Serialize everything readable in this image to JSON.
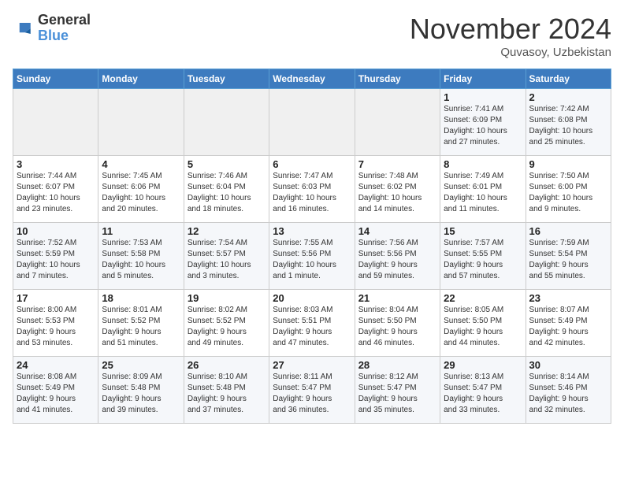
{
  "header": {
    "logo_line1": "General",
    "logo_line2": "Blue",
    "month_title": "November 2024",
    "location": "Quvasoy, Uzbekistan"
  },
  "days_of_week": [
    "Sunday",
    "Monday",
    "Tuesday",
    "Wednesday",
    "Thursday",
    "Friday",
    "Saturday"
  ],
  "weeks": [
    [
      {
        "day": "",
        "info": ""
      },
      {
        "day": "",
        "info": ""
      },
      {
        "day": "",
        "info": ""
      },
      {
        "day": "",
        "info": ""
      },
      {
        "day": "",
        "info": ""
      },
      {
        "day": "1",
        "info": "Sunrise: 7:41 AM\nSunset: 6:09 PM\nDaylight: 10 hours\nand 27 minutes."
      },
      {
        "day": "2",
        "info": "Sunrise: 7:42 AM\nSunset: 6:08 PM\nDaylight: 10 hours\nand 25 minutes."
      }
    ],
    [
      {
        "day": "3",
        "info": "Sunrise: 7:44 AM\nSunset: 6:07 PM\nDaylight: 10 hours\nand 23 minutes."
      },
      {
        "day": "4",
        "info": "Sunrise: 7:45 AM\nSunset: 6:06 PM\nDaylight: 10 hours\nand 20 minutes."
      },
      {
        "day": "5",
        "info": "Sunrise: 7:46 AM\nSunset: 6:04 PM\nDaylight: 10 hours\nand 18 minutes."
      },
      {
        "day": "6",
        "info": "Sunrise: 7:47 AM\nSunset: 6:03 PM\nDaylight: 10 hours\nand 16 minutes."
      },
      {
        "day": "7",
        "info": "Sunrise: 7:48 AM\nSunset: 6:02 PM\nDaylight: 10 hours\nand 14 minutes."
      },
      {
        "day": "8",
        "info": "Sunrise: 7:49 AM\nSunset: 6:01 PM\nDaylight: 10 hours\nand 11 minutes."
      },
      {
        "day": "9",
        "info": "Sunrise: 7:50 AM\nSunset: 6:00 PM\nDaylight: 10 hours\nand 9 minutes."
      }
    ],
    [
      {
        "day": "10",
        "info": "Sunrise: 7:52 AM\nSunset: 5:59 PM\nDaylight: 10 hours\nand 7 minutes."
      },
      {
        "day": "11",
        "info": "Sunrise: 7:53 AM\nSunset: 5:58 PM\nDaylight: 10 hours\nand 5 minutes."
      },
      {
        "day": "12",
        "info": "Sunrise: 7:54 AM\nSunset: 5:57 PM\nDaylight: 10 hours\nand 3 minutes."
      },
      {
        "day": "13",
        "info": "Sunrise: 7:55 AM\nSunset: 5:56 PM\nDaylight: 10 hours\nand 1 minute."
      },
      {
        "day": "14",
        "info": "Sunrise: 7:56 AM\nSunset: 5:56 PM\nDaylight: 9 hours\nand 59 minutes."
      },
      {
        "day": "15",
        "info": "Sunrise: 7:57 AM\nSunset: 5:55 PM\nDaylight: 9 hours\nand 57 minutes."
      },
      {
        "day": "16",
        "info": "Sunrise: 7:59 AM\nSunset: 5:54 PM\nDaylight: 9 hours\nand 55 minutes."
      }
    ],
    [
      {
        "day": "17",
        "info": "Sunrise: 8:00 AM\nSunset: 5:53 PM\nDaylight: 9 hours\nand 53 minutes."
      },
      {
        "day": "18",
        "info": "Sunrise: 8:01 AM\nSunset: 5:52 PM\nDaylight: 9 hours\nand 51 minutes."
      },
      {
        "day": "19",
        "info": "Sunrise: 8:02 AM\nSunset: 5:52 PM\nDaylight: 9 hours\nand 49 minutes."
      },
      {
        "day": "20",
        "info": "Sunrise: 8:03 AM\nSunset: 5:51 PM\nDaylight: 9 hours\nand 47 minutes."
      },
      {
        "day": "21",
        "info": "Sunrise: 8:04 AM\nSunset: 5:50 PM\nDaylight: 9 hours\nand 46 minutes."
      },
      {
        "day": "22",
        "info": "Sunrise: 8:05 AM\nSunset: 5:50 PM\nDaylight: 9 hours\nand 44 minutes."
      },
      {
        "day": "23",
        "info": "Sunrise: 8:07 AM\nSunset: 5:49 PM\nDaylight: 9 hours\nand 42 minutes."
      }
    ],
    [
      {
        "day": "24",
        "info": "Sunrise: 8:08 AM\nSunset: 5:49 PM\nDaylight: 9 hours\nand 41 minutes."
      },
      {
        "day": "25",
        "info": "Sunrise: 8:09 AM\nSunset: 5:48 PM\nDaylight: 9 hours\nand 39 minutes."
      },
      {
        "day": "26",
        "info": "Sunrise: 8:10 AM\nSunset: 5:48 PM\nDaylight: 9 hours\nand 37 minutes."
      },
      {
        "day": "27",
        "info": "Sunrise: 8:11 AM\nSunset: 5:47 PM\nDaylight: 9 hours\nand 36 minutes."
      },
      {
        "day": "28",
        "info": "Sunrise: 8:12 AM\nSunset: 5:47 PM\nDaylight: 9 hours\nand 35 minutes."
      },
      {
        "day": "29",
        "info": "Sunrise: 8:13 AM\nSunset: 5:47 PM\nDaylight: 9 hours\nand 33 minutes."
      },
      {
        "day": "30",
        "info": "Sunrise: 8:14 AM\nSunset: 5:46 PM\nDaylight: 9 hours\nand 32 minutes."
      }
    ]
  ]
}
